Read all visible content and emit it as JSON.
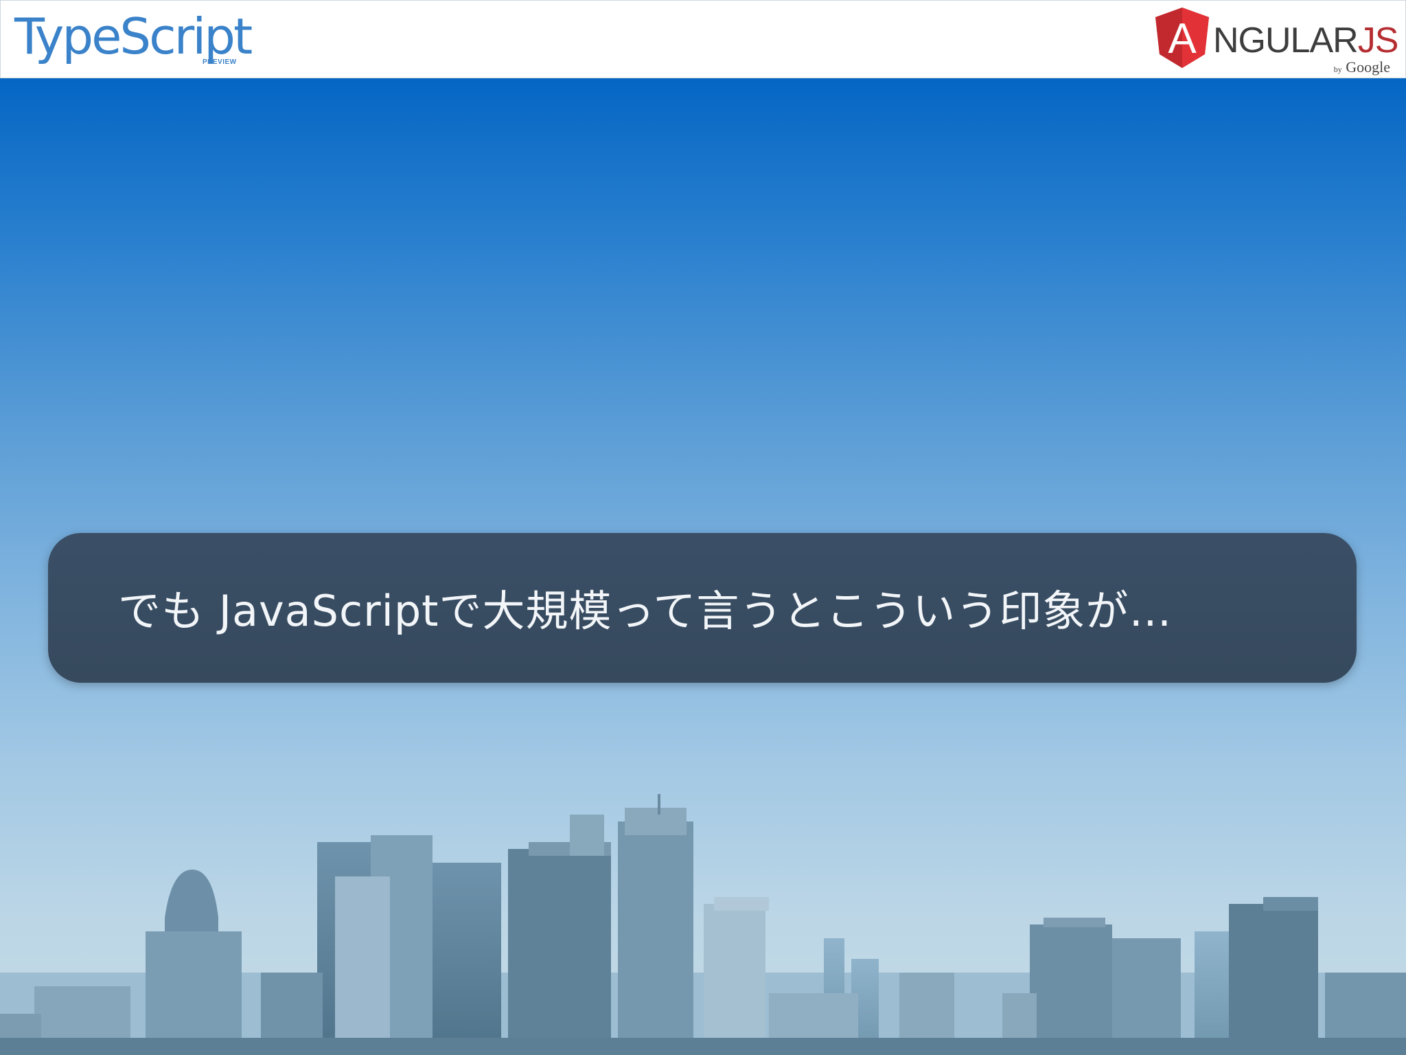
{
  "header": {
    "typescript_logo": {
      "title": "TypeScript",
      "subtitle": "PREVIEW"
    },
    "angular_logo": {
      "letter": "A",
      "text": "NGULAR",
      "suffix": "JS",
      "by": "by",
      "company": "Google"
    }
  },
  "slide": {
    "caption": "でも JavaScriptで大規模って言うとこういう印象が…"
  },
  "colors": {
    "typescript_blue": "#3a82c9",
    "angular_red": "#b52e31",
    "sky_top": "#0566c4",
    "bubble_bg": "#3a4f66"
  },
  "icons": [
    "typescript-logo",
    "angularjs-shield-icon",
    "city-skyline-image"
  ]
}
